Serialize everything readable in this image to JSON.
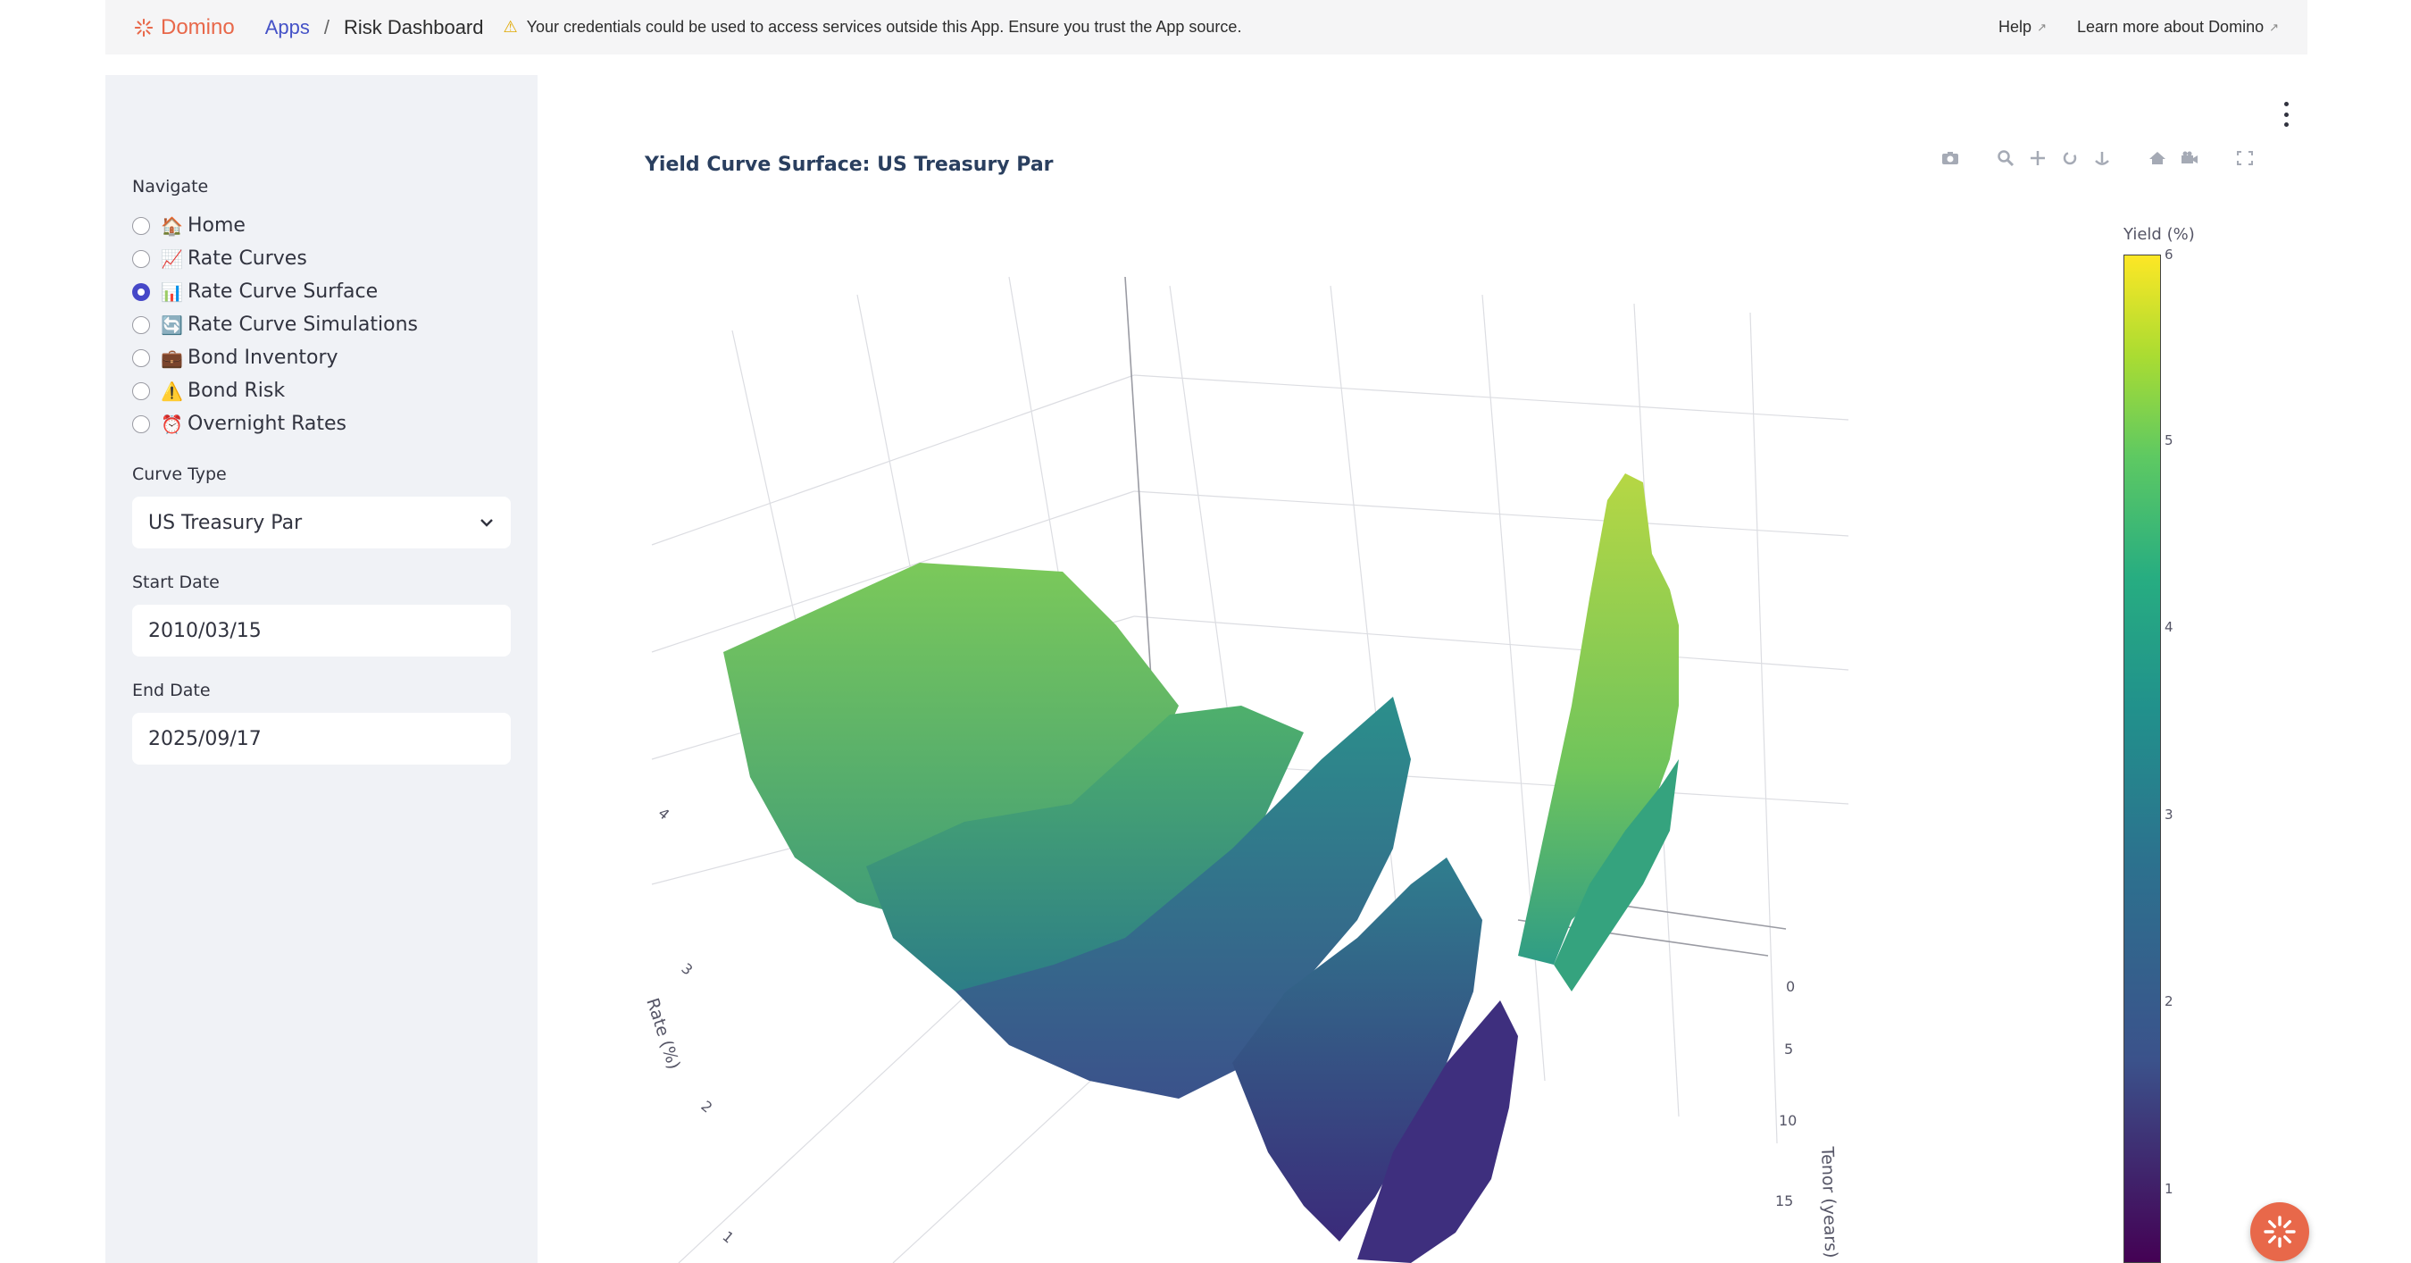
{
  "topbar": {
    "brand": "Domino",
    "breadcrumb_apps": "Apps",
    "breadcrumb_sep": "/",
    "breadcrumb_page": "Risk Dashboard",
    "warning": "Your credentials could be used to access services outside this App. Ensure you trust the App source.",
    "help": "Help",
    "learn_more": "Learn more about Domino"
  },
  "sidebar": {
    "nav_label": "Navigate",
    "nav_items": [
      {
        "icon": "house-emoji",
        "label": "Home",
        "selected": false
      },
      {
        "icon": "chart-up-emoji",
        "label": "Rate Curves",
        "selected": false
      },
      {
        "icon": "bar-chart-emoji",
        "label": "Rate Curve Surface",
        "selected": true
      },
      {
        "icon": "arrows-cycle-emoji",
        "label": "Rate Curve Simulations",
        "selected": false
      },
      {
        "icon": "briefcase-emoji",
        "label": "Bond Inventory",
        "selected": false
      },
      {
        "icon": "warning-emoji",
        "label": "Bond Risk",
        "selected": false
      },
      {
        "icon": "alarm-clock-emoji",
        "label": "Overnight Rates",
        "selected": false
      }
    ],
    "curve_type_label": "Curve Type",
    "curve_type_value": "US Treasury Par",
    "start_date_label": "Start Date",
    "start_date_value": "2010/03/15",
    "end_date_label": "End Date",
    "end_date_value": "2025/09/17"
  },
  "chart_data": {
    "type": "surface",
    "title": "Yield Curve Surface: US Treasury Par",
    "zlabel": "Rate (%)",
    "ylabel": "Tenor (years)",
    "z_ticks": [
      "1",
      "2",
      "3",
      "4"
    ],
    "y_ticks": [
      "0",
      "5",
      "10",
      "15"
    ],
    "colorbar": {
      "title": "Yield (%)",
      "ticks": [
        "1",
        "2",
        "3",
        "4",
        "5",
        "6"
      ],
      "colorscale": "viridis"
    }
  },
  "colors": {
    "accent": "#4648c8",
    "brand": "#e8684a",
    "sidebar_bg": "#f0f2f6"
  }
}
